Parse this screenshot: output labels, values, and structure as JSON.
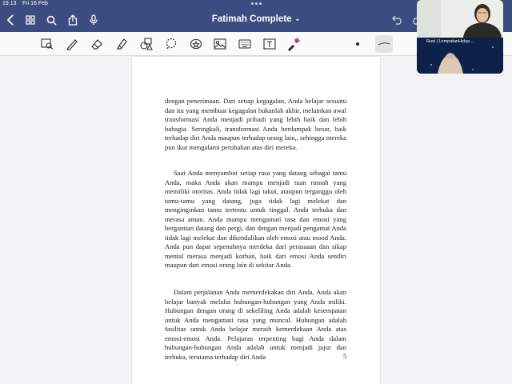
{
  "status_bar": {
    "time": "19.13",
    "date": "Fri 16 Feb"
  },
  "title_bar": {
    "title": "Fatimah Complete",
    "icons": [
      "back-chevron-icon",
      "grid-icon",
      "search-icon",
      "share-icon",
      "microphone-icon",
      "undo-icon"
    ]
  },
  "toolbar": {
    "tools": [
      "zoom-lasso",
      "pen",
      "eraser",
      "highlighter",
      "shapes",
      "lasso",
      "sticker",
      "image",
      "keyboard",
      "text-box",
      "laser-pointer"
    ],
    "accent": "#3d4c80"
  },
  "document": {
    "paragraphs": [
      "dengan penerimaan. Dari setiap kegagalan, Anda belajar sesuatu dan itu yang membuat kegagalan bukanlah akhir, melainkan awal transformasi Anda menjadi pribadi yang lebih baik dan lebih bahagia. Seringkali, transformasi Anda berdampak besar, baik terhadap diri Anda maupun terhadap orang lain,, sehingga mereka pun ikut mengalami perubahan atas diri mereka.",
      "Saat Anda menyambut setiap rasa yang datang sebagai tamu Anda, maka Anda akan mampu menjadi tuan rumah yang memiliki otoritas. Anda tidak lagi takut, ataupun terganggu oleh tamu-tamu yang datang, juga tidak lagi melekat dan menginginkan tamu tertentu untuk tinggal. Anda terbuka dan merasa aman. Anda mampu mengamati rasa dan emosi yang bergantian datang dan pergi, dan dengan menjadi pengamat Anda tidak lagi melekat dan dikendalikan oleh emosi atau mood Anda. Anda pun dapat sepenuhnya merdeka dari perasaaan dan sikap mental merasa menjadi korban, baik dari emosi Anda sendiri maupun dari emosi orang lain di sekitar Anda.",
      "Dalam perjalanan Anda memerdekakan diri Anda, Anda akan belajar banyak melalui hubungan-hubungan yang Anda miliki. Hubungan dengan orang di sekeliling Anda adalah kesempatan untuk Anda mengamati rasa yang muncul. Hubungan adalah fasilitas untuk Anda belajar meraih kemerdekaan Anda atas emosi-emosi Anda. Pelajaran terpenting bagi Anda dalam hubungan-hubungan Anda adalah untuk menjadi jujur dan terbuka, terutama terhadap diri Anda"
    ],
    "page_number": "5"
  },
  "video_call": {
    "participant_name": "Rusi | LompatanHidup..."
  }
}
